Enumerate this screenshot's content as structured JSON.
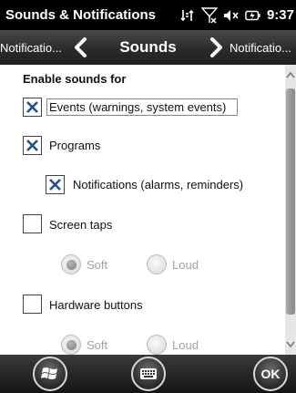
{
  "window": {
    "title": "Sounds & Notifications",
    "time": "9:37"
  },
  "status_icons": [
    "connectivity-icon",
    "signal-off-icon",
    "speaker-muted-icon",
    "battery-charging-icon"
  ],
  "nav": {
    "prev_label": "Notificatio...",
    "current": "Sounds",
    "next_label": "Notificatio..."
  },
  "main": {
    "section_title": "Enable sounds for",
    "options": [
      {
        "label": "Events (warnings, system events)",
        "checked": true
      },
      {
        "label": "Programs",
        "checked": true
      },
      {
        "label": "Notifications (alarms, reminders)",
        "checked": true
      },
      {
        "label": "Screen taps",
        "checked": false
      },
      {
        "label": "Hardware buttons",
        "checked": false
      }
    ],
    "screen_taps_radios": [
      {
        "label": "Soft",
        "selected": true
      },
      {
        "label": "Loud",
        "selected": false
      }
    ],
    "hardware_radios": [
      {
        "label": "Soft",
        "selected": true
      },
      {
        "label": "Loud",
        "selected": false
      }
    ]
  },
  "bottom": {
    "ok_label": "OK"
  },
  "colors": {
    "title_bg": "#000000",
    "content_bg": "#ffffff",
    "disabled_text": "#a3a3a3"
  }
}
